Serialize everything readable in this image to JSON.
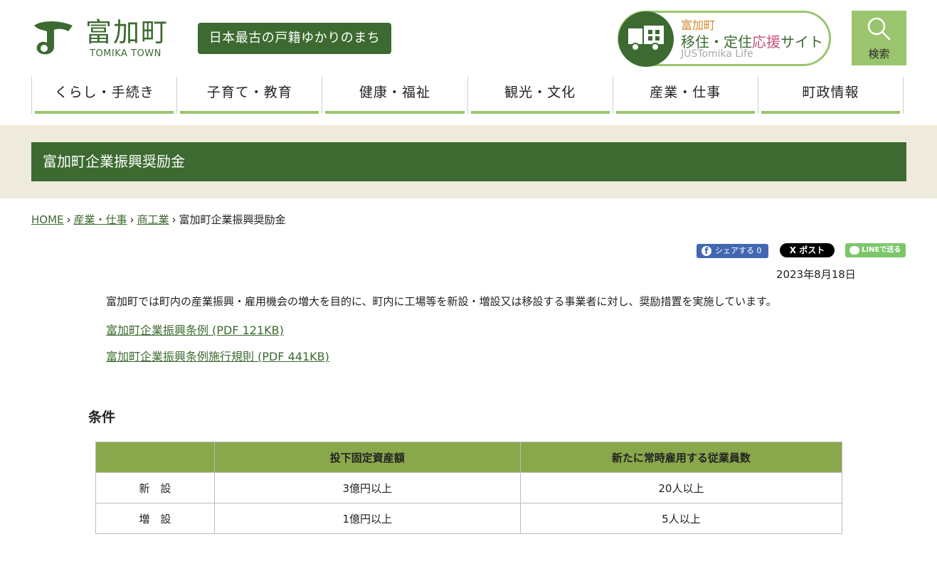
{
  "header": {
    "logo_ja": "富加町",
    "logo_en": "TOMIKA TOWN",
    "tagline": "日本最古の戸籍ゆかりのまち",
    "iju": {
      "line1": "富加町",
      "line2_a": "移住・定住",
      "line2_b": "応援",
      "line2_c": "サイト",
      "line3": "JUSTomika Life"
    },
    "search_label": "検索"
  },
  "nav": [
    {
      "label": "くらし・手続き"
    },
    {
      "label": "子育て・教育"
    },
    {
      "label": "健康・福祉"
    },
    {
      "label": "観光・文化"
    },
    {
      "label": "産業・仕事"
    },
    {
      "label": "町政情報"
    }
  ],
  "page": {
    "title": "富加町企業振興奨励金",
    "breadcrumb": [
      "HOME",
      "産業・仕事",
      "商工業",
      "富加町企業振興奨励金"
    ],
    "share": {
      "facebook": "シェアする 0",
      "x": "X ポスト",
      "line": "LINEで送る"
    },
    "date": "2023年8月18日",
    "intro": "富加町では町内の産業振興・雇用機会の増大を目的に、町内に工場等を新設・増設又は移設する事業者に対し、奨励措置を実施しています。",
    "links": [
      "富加町企業振興条例 (PDF 121KB)",
      "富加町企業振興条例施行規則 (PDF 441KB)"
    ],
    "section_heading": "条件"
  },
  "table": {
    "headers": [
      "",
      "投下固定資産額",
      "新たに常時雇用する従業員数"
    ],
    "rows": [
      [
        "新　設",
        "3億円以上",
        "20人以上"
      ],
      [
        "増　設",
        "1億円以上",
        "5人以上"
      ]
    ]
  },
  "colors": {
    "brand_green": "#3c6a30",
    "light_green": "#9ac46e",
    "table_header": "#89a84c",
    "band_beige": "#eeebdc"
  }
}
